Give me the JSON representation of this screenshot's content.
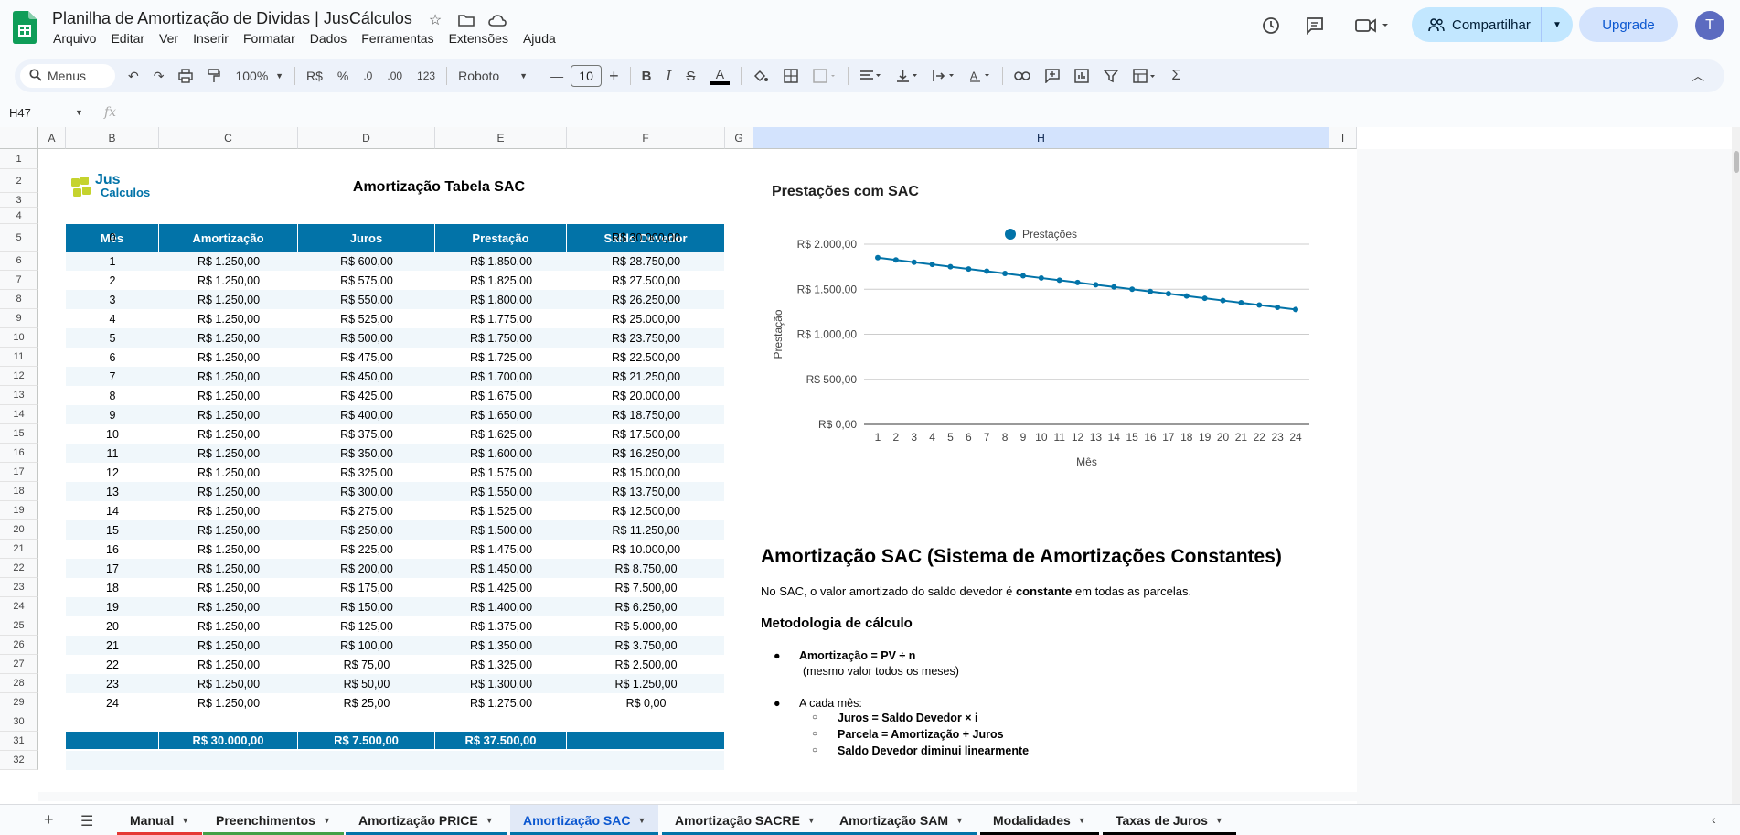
{
  "app": {
    "title": "Planilha de Amortização de Dividas | JusCálculos",
    "menu": [
      "Arquivo",
      "Editar",
      "Ver",
      "Inserir",
      "Formatar",
      "Dados",
      "Ferramentas",
      "Extensões",
      "Ajuda"
    ],
    "share_label": "Compartilhar",
    "upgrade_label": "Upgrade",
    "avatar_letter": "T"
  },
  "toolbar": {
    "menus_label": "Menus",
    "zoom": "100%",
    "currency": "R$",
    "percent": "%",
    "dec_decrease": ".0",
    "dec_increase": ".00",
    "number_format": "123",
    "font": "Roboto",
    "font_size": "10"
  },
  "formula_bar": {
    "cell_ref": "H47",
    "fx": "fx"
  },
  "columns": [
    "A",
    "B",
    "C",
    "D",
    "E",
    "F",
    "G",
    "H",
    "I"
  ],
  "sheet": {
    "logo_jus": "Jus",
    "logo_calculos": "Calculos",
    "title": "Amortização Tabela SAC",
    "headers": [
      "Mês",
      "Amortização",
      "Juros",
      "Prestação",
      "Saldo Devedor"
    ],
    "rows": [
      [
        "0",
        "",
        "",
        "",
        "R$ 30.000,00"
      ],
      [
        "1",
        "R$ 1.250,00",
        "R$ 600,00",
        "R$ 1.850,00",
        "R$ 28.750,00"
      ],
      [
        "2",
        "R$ 1.250,00",
        "R$ 575,00",
        "R$ 1.825,00",
        "R$ 27.500,00"
      ],
      [
        "3",
        "R$ 1.250,00",
        "R$ 550,00",
        "R$ 1.800,00",
        "R$ 26.250,00"
      ],
      [
        "4",
        "R$ 1.250,00",
        "R$ 525,00",
        "R$ 1.775,00",
        "R$ 25.000,00"
      ],
      [
        "5",
        "R$ 1.250,00",
        "R$ 500,00",
        "R$ 1.750,00",
        "R$ 23.750,00"
      ],
      [
        "6",
        "R$ 1.250,00",
        "R$ 475,00",
        "R$ 1.725,00",
        "R$ 22.500,00"
      ],
      [
        "7",
        "R$ 1.250,00",
        "R$ 450,00",
        "R$ 1.700,00",
        "R$ 21.250,00"
      ],
      [
        "8",
        "R$ 1.250,00",
        "R$ 425,00",
        "R$ 1.675,00",
        "R$ 20.000,00"
      ],
      [
        "9",
        "R$ 1.250,00",
        "R$ 400,00",
        "R$ 1.650,00",
        "R$ 18.750,00"
      ],
      [
        "10",
        "R$ 1.250,00",
        "R$ 375,00",
        "R$ 1.625,00",
        "R$ 17.500,00"
      ],
      [
        "11",
        "R$ 1.250,00",
        "R$ 350,00",
        "R$ 1.600,00",
        "R$ 16.250,00"
      ],
      [
        "12",
        "R$ 1.250,00",
        "R$ 325,00",
        "R$ 1.575,00",
        "R$ 15.000,00"
      ],
      [
        "13",
        "R$ 1.250,00",
        "R$ 300,00",
        "R$ 1.550,00",
        "R$ 13.750,00"
      ],
      [
        "14",
        "R$ 1.250,00",
        "R$ 275,00",
        "R$ 1.525,00",
        "R$ 12.500,00"
      ],
      [
        "15",
        "R$ 1.250,00",
        "R$ 250,00",
        "R$ 1.500,00",
        "R$ 11.250,00"
      ],
      [
        "16",
        "R$ 1.250,00",
        "R$ 225,00",
        "R$ 1.475,00",
        "R$ 10.000,00"
      ],
      [
        "17",
        "R$ 1.250,00",
        "R$ 200,00",
        "R$ 1.450,00",
        "R$ 8.750,00"
      ],
      [
        "18",
        "R$ 1.250,00",
        "R$ 175,00",
        "R$ 1.425,00",
        "R$ 7.500,00"
      ],
      [
        "19",
        "R$ 1.250,00",
        "R$ 150,00",
        "R$ 1.400,00",
        "R$ 6.250,00"
      ],
      [
        "20",
        "R$ 1.250,00",
        "R$ 125,00",
        "R$ 1.375,00",
        "R$ 5.000,00"
      ],
      [
        "21",
        "R$ 1.250,00",
        "R$ 100,00",
        "R$ 1.350,00",
        "R$ 3.750,00"
      ],
      [
        "22",
        "R$ 1.250,00",
        "R$ 75,00",
        "R$ 1.325,00",
        "R$ 2.500,00"
      ],
      [
        "23",
        "R$ 1.250,00",
        "R$ 50,00",
        "R$ 1.300,00",
        "R$ 1.250,00"
      ],
      [
        "24",
        "R$ 1.250,00",
        "R$ 25,00",
        "R$ 1.275,00",
        "R$ 0,00"
      ]
    ],
    "totals": [
      "",
      "R$ 30.000,00",
      "R$ 7.500,00",
      "R$ 37.500,00",
      ""
    ]
  },
  "chart_data": {
    "type": "line",
    "title": "Prestações com SAC",
    "xlabel": "Mês",
    "ylabel": "Prestação",
    "legend_position": "top",
    "grid": true,
    "ylim": [
      0,
      2000
    ],
    "y_ticks": [
      "R$ 0,00",
      "R$ 500,00",
      "R$ 1.000,00",
      "R$ 1.500,00",
      "R$ 2.000,00"
    ],
    "categories": [
      "1",
      "2",
      "3",
      "4",
      "5",
      "6",
      "7",
      "8",
      "9",
      "10",
      "11",
      "12",
      "13",
      "14",
      "15",
      "16",
      "17",
      "18",
      "19",
      "20",
      "21",
      "22",
      "23",
      "24"
    ],
    "series": [
      {
        "name": "Prestações",
        "color": "#0273a8",
        "values": [
          1850,
          1825,
          1800,
          1775,
          1750,
          1725,
          1700,
          1675,
          1650,
          1625,
          1600,
          1575,
          1550,
          1525,
          1500,
          1475,
          1450,
          1425,
          1400,
          1375,
          1350,
          1325,
          1300,
          1275
        ]
      }
    ]
  },
  "notes": {
    "heading": "Amortização SAC (Sistema de Amortizações Constantes)",
    "intro_before": "No SAC, o valor amortizado do saldo devedor é ",
    "intro_bold": "constante",
    "intro_after": " em todas as parcelas.",
    "method_heading": "Metodologia de cálculo",
    "bullet1_bold": "Amortização = PV ÷ n",
    "bullet1_sub": "(mesmo valor todos os meses)",
    "bullet2": "A cada mês:",
    "sub1": "Juros = Saldo Devedor × i",
    "sub2": "Parcela = Amortização + Juros",
    "sub3": "Saldo Devedor diminui linearmente"
  },
  "tabs": [
    {
      "label": "Manual",
      "color": "#e53935"
    },
    {
      "label": "Preenchimentos",
      "color": "#43a047"
    },
    {
      "label": "Amortização PRICE",
      "color": "#0273a8"
    },
    {
      "label": "Amortização SAC",
      "color": "#0273a8",
      "active": true
    },
    {
      "label": "Amortização SACRE",
      "color": "#0273a8"
    },
    {
      "label": "Amortização SAM",
      "color": "#0273a8"
    },
    {
      "label": "Modalidades",
      "color": "#000000"
    },
    {
      "label": "Taxas de Juros",
      "color": "#000000"
    }
  ]
}
